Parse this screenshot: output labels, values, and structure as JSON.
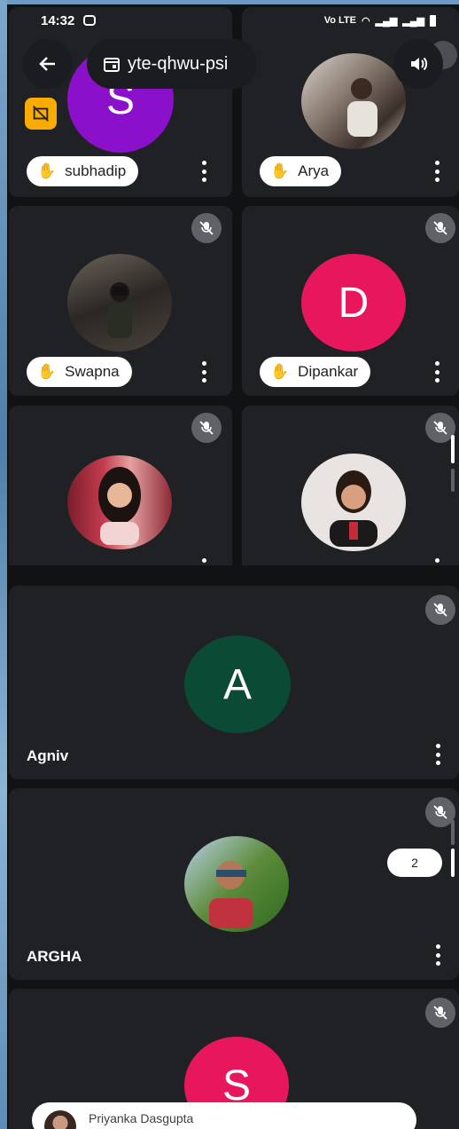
{
  "status_bar": {
    "time": "14:32",
    "network": "Vo LTE"
  },
  "meeting": {
    "code": "yte-qhwu-psi"
  },
  "tiles": [
    {
      "name": "subhadip",
      "initial": "S",
      "color": "#8b10c9",
      "hand_raised": true,
      "camera_off_badge": true
    },
    {
      "name": "Arya",
      "photo": true,
      "hand_raised": true
    },
    {
      "name": "Swapna",
      "photo": true,
      "hand_raised": true
    },
    {
      "name": "Dipankar",
      "initial": "D",
      "color": "#e8175d",
      "hand_raised": true
    },
    {
      "name": "",
      "photo": true
    },
    {
      "name": "",
      "photo": true
    },
    {
      "name": "Agniv",
      "initial": "A",
      "color": "#0b4a34"
    },
    {
      "name": "ARGHA",
      "photo": true
    },
    {
      "name": "",
      "initial": "S",
      "color": "#e8175d"
    }
  ],
  "badge": {
    "count": "2"
  },
  "toast": {
    "name": "Priyanka Dasgupta"
  },
  "colors": {
    "tile_bg": "#202124",
    "page_bg": "#111214",
    "accent_yellow": "#f9ab00"
  }
}
